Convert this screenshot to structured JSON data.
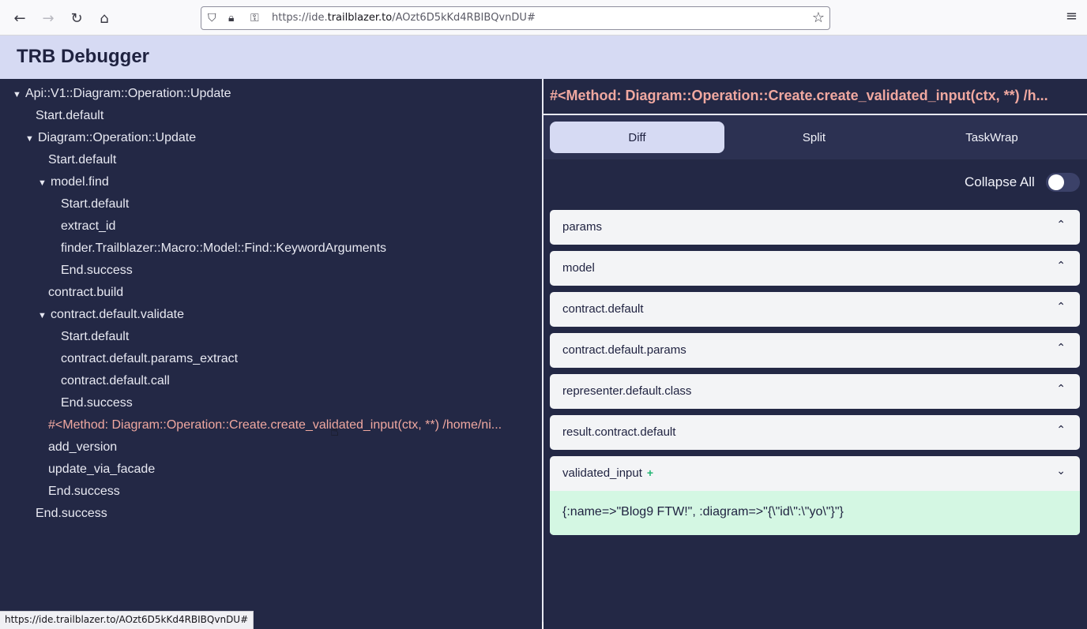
{
  "browser": {
    "back_icon": "arrow-left-icon",
    "forward_icon": "arrow-right-icon",
    "reload_icon": "reload-icon",
    "home_icon": "home-icon",
    "url_prefix": "https://ide.",
    "url_host": "trailblazer.to",
    "url_path": "/AOzt6D5kKd4RBIBQvnDU#",
    "status_url": "https://ide.trailblazer.to/AOzt6D5kKd4RBIBQvnDU#"
  },
  "app": {
    "title": "TRB Debugger"
  },
  "tree": {
    "items": [
      {
        "label": "Api::V1::Diagram::Operation::Update",
        "expanded": true
      },
      {
        "label": "Start.default"
      },
      {
        "label": "Diagram::Operation::Update",
        "expanded": true
      },
      {
        "label": "Start.default"
      },
      {
        "label": "model.find",
        "expanded": true
      },
      {
        "label": "Start.default"
      },
      {
        "label": "extract_id"
      },
      {
        "label": "finder.Trailblazer::Macro::Model::Find::KeywordArguments"
      },
      {
        "label": "End.success"
      },
      {
        "label": "contract.build"
      },
      {
        "label": "contract.default.validate",
        "expanded": true
      },
      {
        "label": "Start.default"
      },
      {
        "label": "contract.default.params_extract"
      },
      {
        "label": "contract.default.call"
      },
      {
        "label": "End.success"
      },
      {
        "label": "#<Method: Diagram::Operation::Create.create_validated_input(ctx, **) /home/ni..."
      },
      {
        "label": "add_version"
      },
      {
        "label": "update_via_facade"
      },
      {
        "label": "End.success"
      },
      {
        "label": "End.success"
      }
    ],
    "caret": "▼"
  },
  "detail": {
    "title": "#<Method: Diagram::Operation::Create.create_validated_input(ctx, **) /h...",
    "tabs": [
      {
        "label": "Diff",
        "selected": true
      },
      {
        "label": "Split"
      },
      {
        "label": "TaskWrap"
      }
    ],
    "collapse_all_label": "Collapse All",
    "collapse_all_on": false,
    "sections": [
      {
        "label": "params"
      },
      {
        "label": "model"
      },
      {
        "label": "contract.default"
      },
      {
        "label": "contract.default.params"
      },
      {
        "label": "representer.default.class"
      },
      {
        "label": "result.contract.default"
      },
      {
        "label": "validated_input",
        "badge": "+",
        "value": "{:name=>\"Blog9 FTW!\", :diagram=>\"{\\\"id\\\":\\\"yo\\\"}\"}"
      }
    ]
  },
  "colors": {
    "header_bg": "#d6daf3",
    "panel_bg": "#232845",
    "active_text": "#f0a8a0",
    "added_bg": "#d4f7e3",
    "added_badge": "#22b573"
  }
}
